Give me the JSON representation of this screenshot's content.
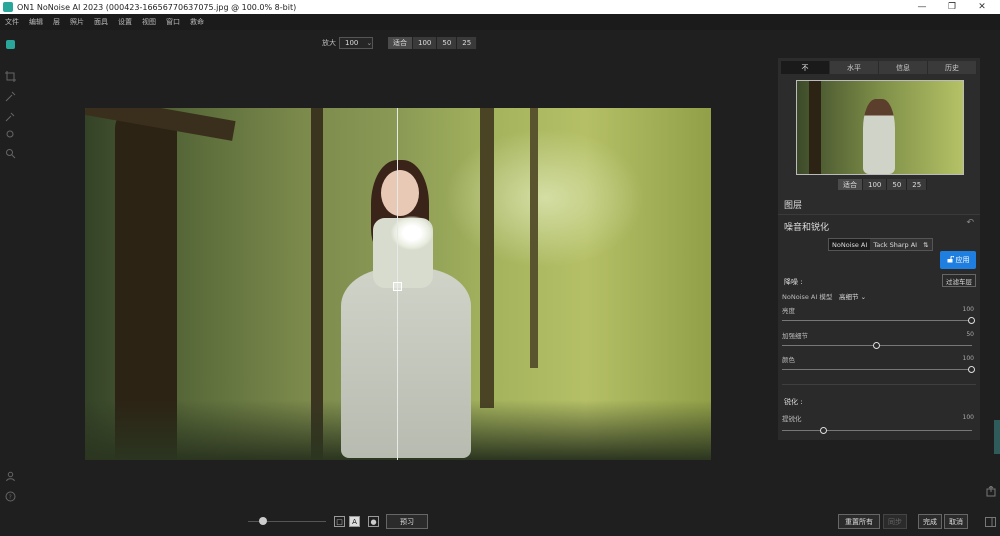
{
  "window": {
    "title": "ON1 NoNoise AI 2023 (000423-16656770637075.jpg @ 100.0% 8-bit)",
    "min": "—",
    "max": "❐",
    "close": "✕"
  },
  "menu": [
    "文件",
    "编辑",
    "层",
    "照片",
    "面具",
    "设置",
    "视图",
    "窗口",
    "救命"
  ],
  "zoom": {
    "label": "放大",
    "value": "100",
    "caret": "⌄",
    "presets": [
      "适合",
      "100",
      "50",
      "25"
    ]
  },
  "right": {
    "tabs": [
      "不",
      "水平",
      "信息",
      "历史"
    ],
    "thumb_presets": [
      "适合",
      "100",
      "50",
      "25"
    ],
    "layers_title": "图层",
    "section_title": "噪音和锐化",
    "undo_icon": "↶",
    "models": [
      "NoNoise AI",
      "Tack Sharp AI"
    ],
    "model_toggle": "⇅",
    "apply": "应用",
    "filter_button": "过滤车层",
    "noise": {
      "title": "降噪 :",
      "model_label": "NoNoise AI 模型",
      "model_value": "高细节",
      "model_caret": "⌄",
      "sliders": [
        {
          "label": "亮度",
          "value": "100",
          "level": 1.0
        },
        {
          "label": "加强细节",
          "value": "50",
          "level": 0.5
        },
        {
          "label": "颜色",
          "value": "100",
          "level": 1.0
        }
      ]
    },
    "sharpen": {
      "title": "锐化 :",
      "sliders": [
        {
          "label": "提锐化",
          "value": "100",
          "level": 0.22
        }
      ]
    }
  },
  "bottom": {
    "view_icons": [
      "□",
      "A",
      "●"
    ],
    "preview": "预习",
    "reset_all": "重置所有",
    "sync": "同步",
    "done": "完成",
    "cancel": "取消"
  },
  "left_tools": [
    "crop-icon",
    "eyedropper-icon",
    "brush-icon",
    "refine-brush-icon",
    "zoom-tool-icon"
  ],
  "colors": {
    "accent": "#1f7fe0",
    "logo": "#2aa79b"
  }
}
